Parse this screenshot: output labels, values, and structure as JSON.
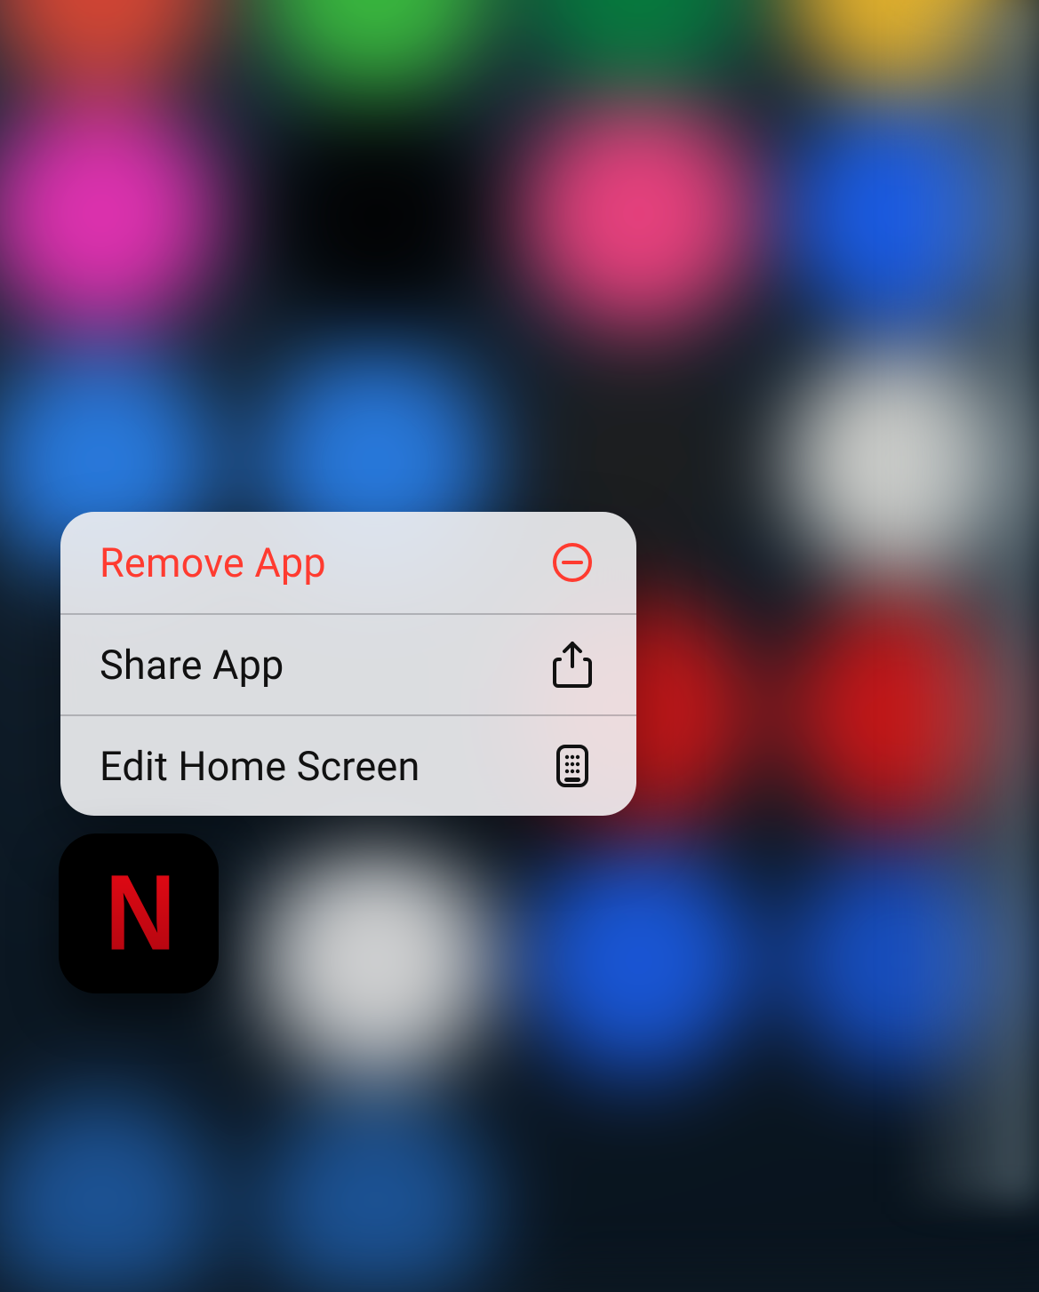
{
  "colors": {
    "destructive": "#ff3b30"
  },
  "context_menu": {
    "items": [
      {
        "label": "Remove App",
        "icon": "minus-circle-icon",
        "destructive": true
      },
      {
        "label": "Share App",
        "icon": "share-icon",
        "destructive": false
      },
      {
        "label": "Edit Home Screen",
        "icon": "apps-grid-icon",
        "destructive": false
      }
    ]
  },
  "focused_app": {
    "name": "Netflix",
    "letter": "N"
  }
}
